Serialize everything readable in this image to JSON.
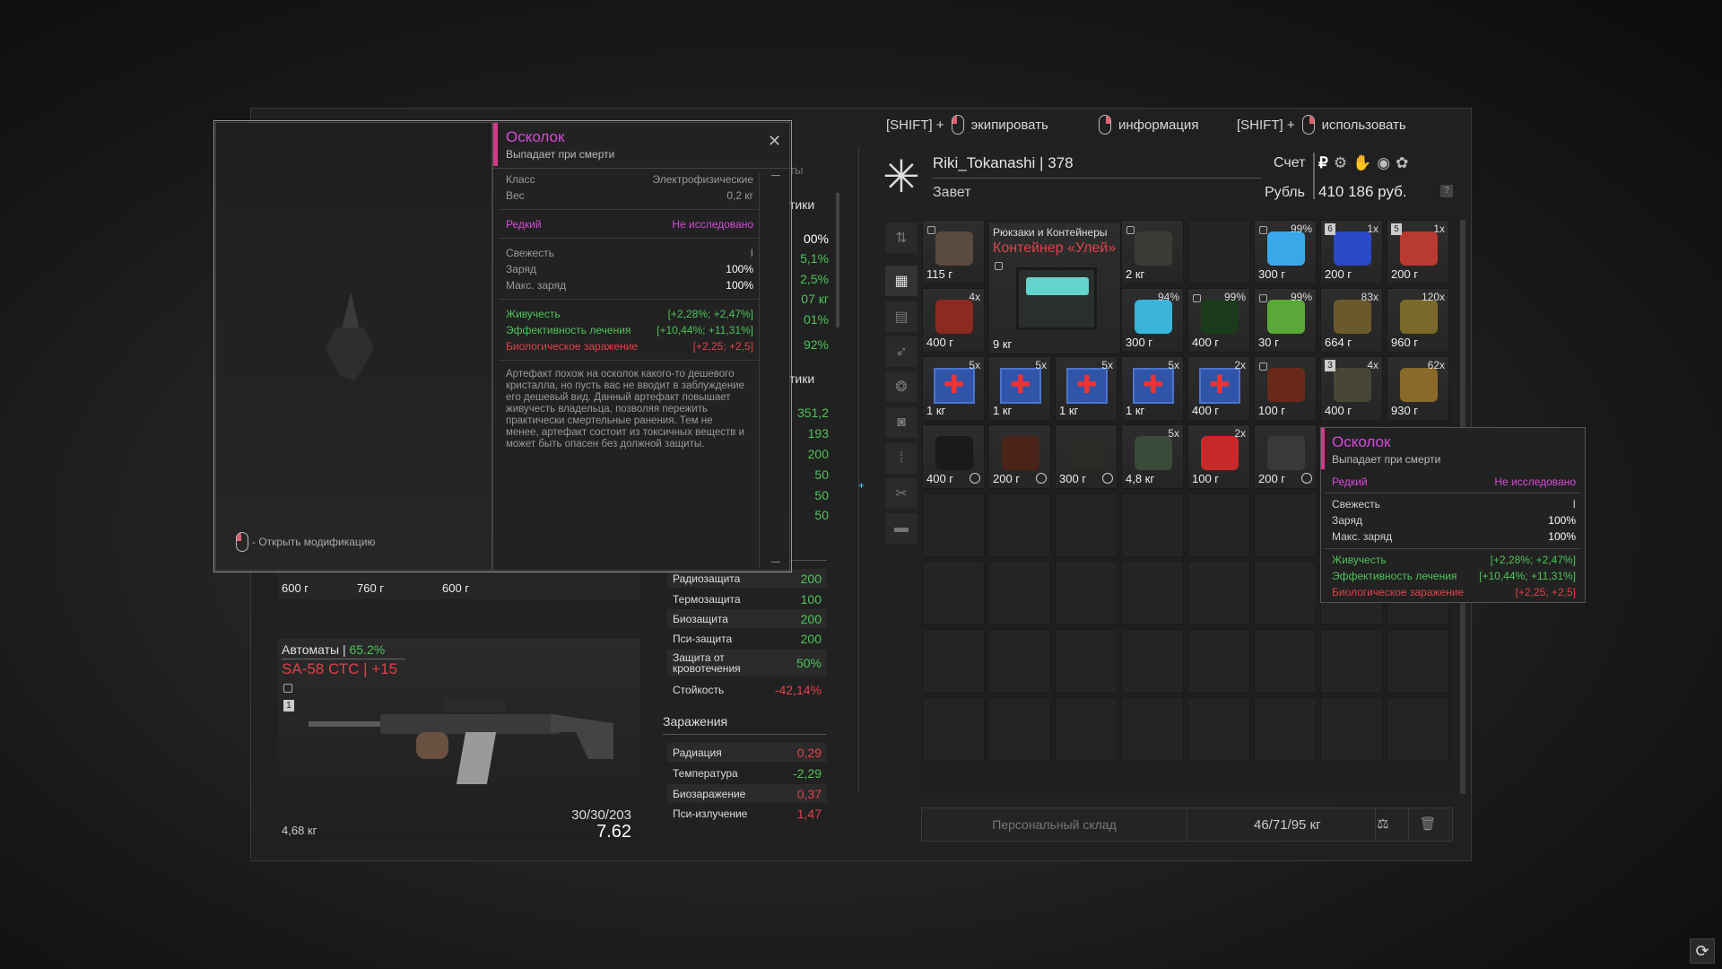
{
  "hints": {
    "shift1": "[SHIFT] +",
    "equip": "экипировать",
    "info": "информация",
    "shift2": "[SHIFT] +",
    "use": "использовать"
  },
  "player": {
    "name_level": "Riki_Tokanashi | 378",
    "faction": "Завет",
    "account_label": "Счет",
    "currency_label": "Рубль",
    "balance": "410 186 руб.",
    "help": "?"
  },
  "grid": {
    "cat_label": "Рюкзаки и Контейнеры",
    "container_name": "Контейнер «Улей»",
    "cells": [
      {
        "c": 0,
        "r": 0,
        "w": "115 г",
        "lock": true,
        "art": "#5a4a40"
      },
      {
        "c": 3,
        "r": 0,
        "w": "2 кг",
        "lock": true,
        "art": "#3c3c36"
      },
      {
        "c": 5,
        "r": 0,
        "w": "300 г",
        "q": "99%",
        "lock": true,
        "art": "#3aa8e8"
      },
      {
        "c": 6,
        "r": 0,
        "w": "200 г",
        "q": "1x",
        "badge": "6",
        "art": "#2a48c8"
      },
      {
        "c": 7,
        "r": 0,
        "w": "200 г",
        "q": "1x",
        "badge": "5",
        "art": "#b83a30"
      },
      {
        "c": 0,
        "r": 1,
        "w": "400 г",
        "q": "4x",
        "art": "#8a2a20"
      },
      {
        "c": 3,
        "r": 1,
        "w": "300 г",
        "q": "94%",
        "art": "#3ab4d8"
      },
      {
        "c": 4,
        "r": 1,
        "w": "400 г",
        "q": "99%",
        "lock": true,
        "art": "#1a3a1a"
      },
      {
        "c": 5,
        "r": 1,
        "w": "30 г",
        "q": "99%",
        "lock": true,
        "art": "#5aa838"
      },
      {
        "c": 6,
        "r": 1,
        "w": "664 г",
        "q": "83x",
        "art": "#6a5a2a"
      },
      {
        "c": 7,
        "r": 1,
        "w": "960 г",
        "q": "120x",
        "art": "#7a6a2a"
      },
      {
        "c": 0,
        "r": 2,
        "w": "1 кг",
        "q": "5x",
        "med": true
      },
      {
        "c": 1,
        "r": 2,
        "w": "1 кг",
        "q": "5x",
        "med": true
      },
      {
        "c": 2,
        "r": 2,
        "w": "1 кг",
        "q": "5x",
        "med": true
      },
      {
        "c": 3,
        "r": 2,
        "w": "1 кг",
        "q": "5x",
        "med": true
      },
      {
        "c": 4,
        "r": 2,
        "w": "400 г",
        "q": "2x",
        "med": true
      },
      {
        "c": 5,
        "r": 2,
        "w": "100 г",
        "lock": true,
        "art": "#6a2a1a"
      },
      {
        "c": 6,
        "r": 2,
        "w": "400 г",
        "q": "4x",
        "badge": "3",
        "art": "#4a4636"
      },
      {
        "c": 7,
        "r": 2,
        "w": "930 г",
        "q": "62x",
        "art": "#8a6a2a"
      },
      {
        "c": 0,
        "r": 3,
        "w": "400 г",
        "clock": true,
        "art": "#1a1a1a"
      },
      {
        "c": 1,
        "r": 3,
        "w": "200 г",
        "clock": true,
        "art": "#4a2418"
      },
      {
        "c": 2,
        "r": 3,
        "w": "300 г",
        "clock": true,
        "art": "#2a2a26"
      },
      {
        "c": 3,
        "r": 3,
        "w": "4,8 кг",
        "q": "5x",
        "art": "#3a4a38"
      },
      {
        "c": 4,
        "r": 3,
        "w": "100 г",
        "q": "2x",
        "art": "#c82a2a"
      },
      {
        "c": 5,
        "r": 3,
        "w": "200 г",
        "clock": true,
        "art": "#3a3a3a"
      }
    ]
  },
  "footer": {
    "stash": "Персональный склад",
    "weight": "46/71/95 кг"
  },
  "open_mod": "- Открыть модификацию",
  "info_panel": {
    "title": "Осколок",
    "subtitle": "Выпадает при смерти",
    "class_l": "Класс",
    "class_v": "Электрофизические",
    "weight_l": "Вес",
    "weight_v": "0,2 кг",
    "rarity": "Редкий",
    "research": "Не исследовано",
    "fresh_l": "Свежесть",
    "fresh_v": "I",
    "charge_l": "Заряд",
    "charge_v": "100%",
    "max_l": "Макс. заряд",
    "max_v": "100%",
    "vit_l": "Живучесть",
    "vit_v": "[+2,28%; +2,47%]",
    "heal_l": "Эффективность лечения",
    "heal_v": "[+10,44%; +11,31%]",
    "bio_l": "Биологическое заражение",
    "bio_v": "[+2,25; +2,5]",
    "desc": "Артефакт похож на осколок какого-то дешевого кристалла, но пусть вас не вводит в заблуждение его дешевый вид. Данный артефакт повышает живучесть владельца, позволяя пережить практически смертельные ранения. Тем не менее, артефакт состоит из токсичных веществ и может быть опасен без должной защиты."
  },
  "tooltip": {
    "title": "Осколок",
    "subtitle": "Выпадает при смерти",
    "rarity": "Редкий",
    "research": "Не исследовано",
    "fresh_l": "Свежесть",
    "fresh_v": "I",
    "charge_l": "Заряд",
    "charge_v": "100%",
    "max_l": "Макс. заряд",
    "max_v": "100%",
    "vit_l": "Живучесть",
    "vit_v": "[+2,28%; +2,47%]",
    "heal_l": "Эффективность лечения",
    "heal_v": "[+10,44%; +11,31%]",
    "bio_l": "Биологическое заражение",
    "bio_v": "[+2,25; +2,5]"
  },
  "partial": {
    "ts": "ты",
    "tiki1": "тики",
    "tiki2": "тики",
    "v": [
      "00%",
      "5,1%",
      "2,5%",
      "07 кг",
      "01%",
      "92%",
      "351,2",
      "193",
      "200",
      "50",
      "50",
      "50"
    ]
  },
  "protection": [
    {
      "l": "Радиозащита",
      "v": "200"
    },
    {
      "l": "Термозащита",
      "v": "100"
    },
    {
      "l": "Биозащита",
      "v": "200"
    },
    {
      "l": "Пси-защита",
      "v": "200"
    },
    {
      "l": "Защита от кровотечения",
      "v": "50%"
    },
    {
      "l": "Стойкость",
      "v": "-42,14%"
    }
  ],
  "contam": {
    "title": "Заражения",
    "rows": [
      {
        "l": "Радиация",
        "v": "0,29"
      },
      {
        "l": "Температура",
        "v": "-2,29"
      },
      {
        "l": "Биозаражение",
        "v": "0,37"
      },
      {
        "l": "Пси-излучение",
        "v": "1,47"
      }
    ]
  },
  "armor_weights": [
    "600 г",
    "760 г",
    "600 г"
  ],
  "weapon": {
    "category": "Автоматы |",
    "pct": "65.2%",
    "name": "SA-58 СТС | +15",
    "slot": "1",
    "weight": "4,68 кг",
    "ammo": "30/30/203",
    "caliber": "7.62"
  },
  "colors": {
    "pink": "#d54ad7",
    "green": "#4fc35a",
    "red": "#e0424a",
    "accent": "#d33a8a"
  }
}
